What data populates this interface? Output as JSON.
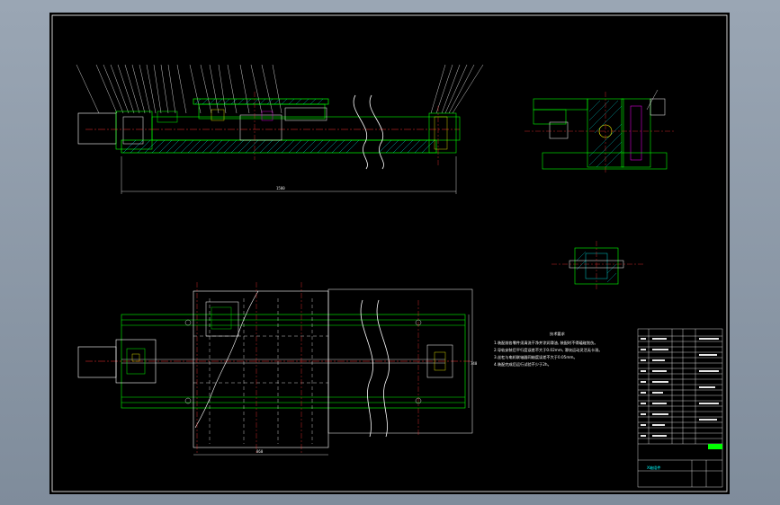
{
  "app": {
    "background": "#8e9aa9",
    "sheet_background": "#000000"
  },
  "colors": {
    "outline": "#ffffff",
    "part": "#00ff00",
    "hatch": "#00ffff",
    "center": "#ff3030",
    "magenta": "#ff00ff",
    "yellow": "#ffff00"
  },
  "views": {
    "front_section": {
      "name": "front-section-view"
    },
    "side_section": {
      "name": "side-section-view"
    },
    "detail": {
      "name": "detail-view"
    },
    "plan": {
      "name": "plan-view"
    }
  },
  "dimensions": {
    "front_overall": "1500",
    "plan_height": "740",
    "plan_width": "860"
  },
  "notes": {
    "title": "技术要求",
    "lines": [
      "1.装配前各零件须清洗干净并涂润滑油, 装配时不得磕碰划伤。",
      "2.导轨安装后平行度误差不大于0.02mm, 滑块运动灵活无卡滞。",
      "3.丝杠与电机联轴器同轴度误差不大于0.05mm。",
      "4.装配完成后运行试验不少于2h。"
    ]
  },
  "title_block": {
    "drawing_title": "X轴组件"
  }
}
